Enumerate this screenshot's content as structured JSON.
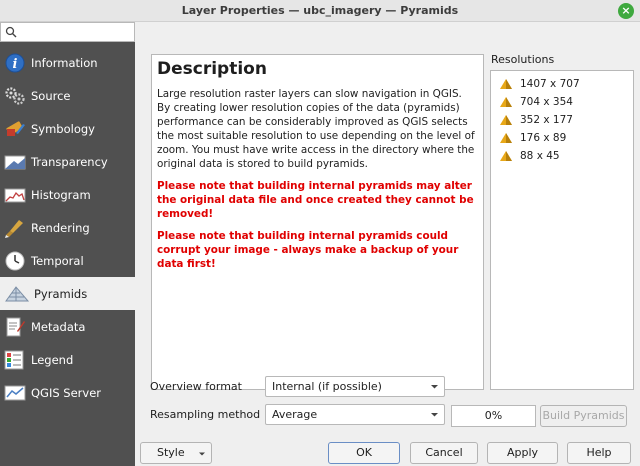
{
  "window": {
    "title": "Layer Properties — ubc_imagery — Pyramids",
    "close_glyph": "×"
  },
  "search": {
    "placeholder": ""
  },
  "sidebar": {
    "items": [
      {
        "label": "Information",
        "icon": "info-icon"
      },
      {
        "label": "Source",
        "icon": "source-icon"
      },
      {
        "label": "Symbology",
        "icon": "symbology-icon"
      },
      {
        "label": "Transparency",
        "icon": "transparency-icon"
      },
      {
        "label": "Histogram",
        "icon": "histogram-icon"
      },
      {
        "label": "Rendering",
        "icon": "rendering-icon"
      },
      {
        "label": "Temporal",
        "icon": "clock-icon"
      },
      {
        "label": "Pyramids",
        "icon": "pyramid-icon",
        "active": true
      },
      {
        "label": "Metadata",
        "icon": "metadata-icon"
      },
      {
        "label": "Legend",
        "icon": "legend-icon"
      },
      {
        "label": "QGIS Server",
        "icon": "server-icon"
      }
    ]
  },
  "description": {
    "heading": "Description",
    "body": "Large resolution raster layers can slow navigation in QGIS. By creating lower resolution copies of the data (pyramids) performance can be considerably improved as QGIS selects the most suitable resolution to use depending on the level of zoom. You must have write access in the directory where the original data is stored to build pyramids.",
    "warning1": "Please note that building internal pyramids may alter the original data file and once created they cannot be removed!",
    "warning2": "Please note that building internal pyramids could corrupt your image - always make a backup of your data first!"
  },
  "resolutions": {
    "label": "Resolutions",
    "items": [
      "1407 x 707",
      "704 x 354",
      "352 x 177",
      "176 x 89",
      "88 x 45"
    ]
  },
  "overview_format": {
    "label": "Overview format",
    "value": "Internal (if possible)"
  },
  "resampling": {
    "label": "Resampling method",
    "value": "Average"
  },
  "progress": {
    "text": "0%"
  },
  "buttons": {
    "build": "Build Pyramids",
    "style": "Style",
    "ok": "OK",
    "cancel": "Cancel",
    "apply": "Apply",
    "help": "Help"
  },
  "colors": {
    "sidebar_bg": "#505050",
    "warning": "#e00000",
    "close_button": "#3fa93f",
    "pyramid": "#e8a818"
  }
}
